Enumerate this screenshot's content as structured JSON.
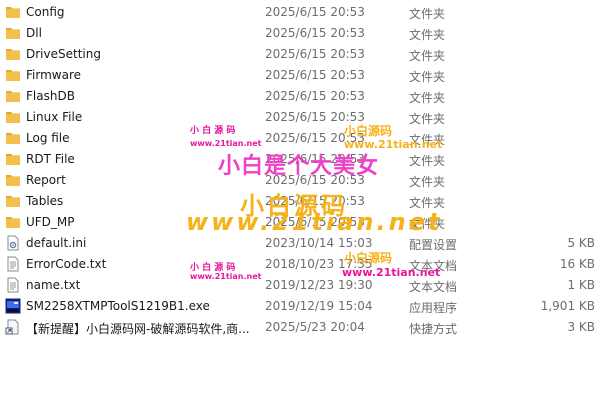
{
  "files": [
    {
      "icon": "folder-icon",
      "name": "Config",
      "date": "2025/6/15 20:53",
      "type": "文件夹",
      "size": ""
    },
    {
      "icon": "folder-icon",
      "name": "Dll",
      "date": "2025/6/15 20:53",
      "type": "文件夹",
      "size": ""
    },
    {
      "icon": "folder-icon",
      "name": "DriveSetting",
      "date": "2025/6/15 20:53",
      "type": "文件夹",
      "size": ""
    },
    {
      "icon": "folder-icon",
      "name": "Firmware",
      "date": "2025/6/15 20:53",
      "type": "文件夹",
      "size": ""
    },
    {
      "icon": "folder-icon",
      "name": "FlashDB",
      "date": "2025/6/15 20:53",
      "type": "文件夹",
      "size": ""
    },
    {
      "icon": "folder-icon",
      "name": "Linux File",
      "date": "2025/6/15 20:53",
      "type": "文件夹",
      "size": ""
    },
    {
      "icon": "folder-icon",
      "name": "Log file",
      "date": "2025/6/15 20:53",
      "type": "文件夹",
      "size": ""
    },
    {
      "icon": "folder-icon",
      "name": "RDT File",
      "date": "2025/6/15 20:53",
      "type": "文件夹",
      "size": ""
    },
    {
      "icon": "folder-icon",
      "name": "Report",
      "date": "2025/6/15 20:53",
      "type": "文件夹",
      "size": ""
    },
    {
      "icon": "folder-icon",
      "name": "Tables",
      "date": "2025/6/15 20:53",
      "type": "文件夹",
      "size": ""
    },
    {
      "icon": "folder-icon",
      "name": "UFD_MP",
      "date": "2025/6/15 20:53",
      "type": "文件夹",
      "size": ""
    },
    {
      "icon": "settings-file-icon",
      "name": "default.ini",
      "date": "2023/10/14 15:03",
      "type": "配置设置",
      "size": "5 KB"
    },
    {
      "icon": "text-file-icon",
      "name": "ErrorCode.txt",
      "date": "2018/10/23 17:35",
      "type": "文本文档",
      "size": "16 KB"
    },
    {
      "icon": "text-file-icon",
      "name": "name.txt",
      "date": "2019/12/23 19:30",
      "type": "文本文档",
      "size": "1 KB"
    },
    {
      "icon": "exe-app-icon",
      "name": "SM2258XTMPToolS1219B1.exe",
      "date": "2019/12/19 15:04",
      "type": "应用程序",
      "size": "1,901 KB"
    },
    {
      "icon": "shortcut-icon",
      "name": "【新提醒】小白源码网-破解源码软件,商...",
      "date": "2025/5/23 20:04",
      "type": "快捷方式",
      "size": "3 KB"
    }
  ],
  "watermarks": {
    "headline": "小白是个大美女",
    "brand_cn": "小白源码",
    "brand_url": "www.21tian.net",
    "small_brand_cn": "小 白 源 码",
    "small_url": "www.21tian.net"
  },
  "colors": {
    "folder": "#f3c04c",
    "watermark_pink": "#ee40c8",
    "watermark_orange": "#f5b21a"
  }
}
